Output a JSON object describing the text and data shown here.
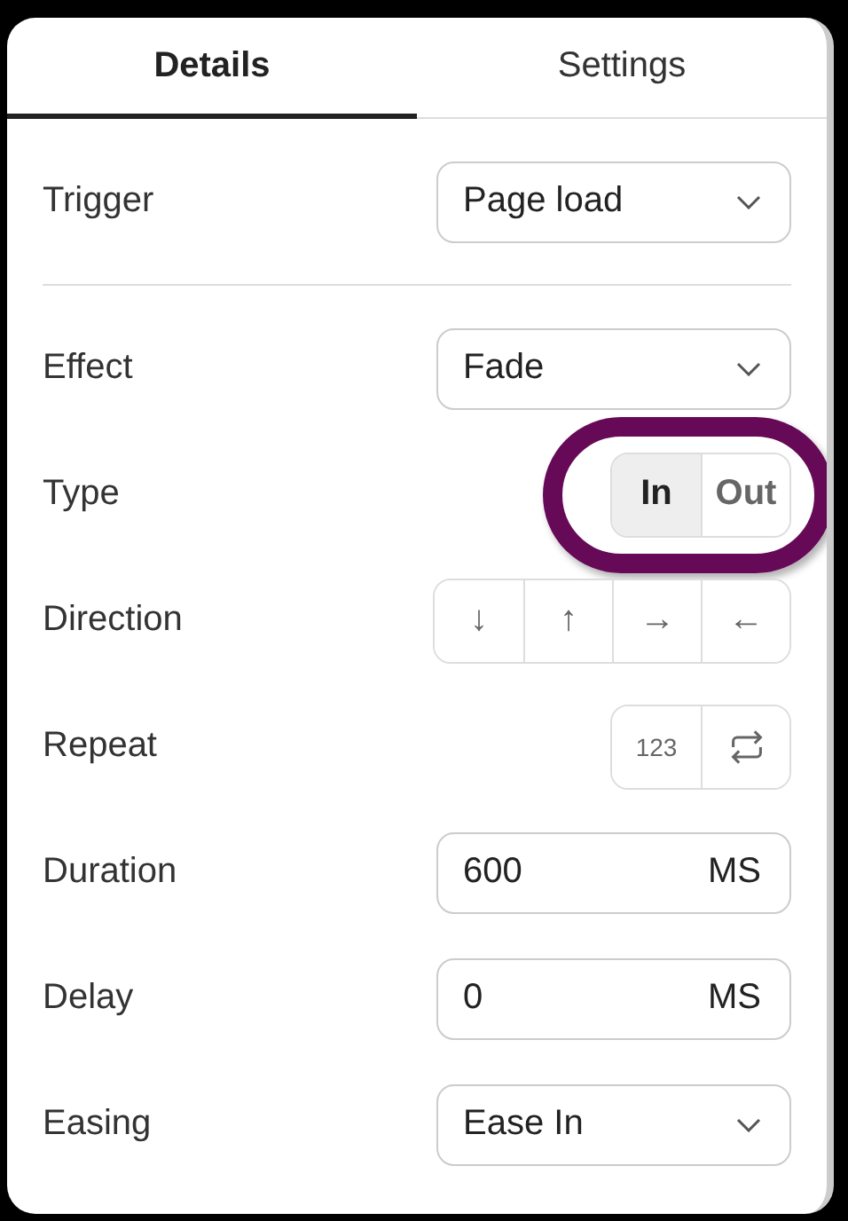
{
  "tabs": [
    {
      "label": "Details",
      "selected": true
    },
    {
      "label": "Settings",
      "selected": false
    }
  ],
  "rows": [
    {
      "kind": "select",
      "label": "Trigger",
      "value": "Page load",
      "divider_after": true
    },
    {
      "kind": "select",
      "label": "Effect",
      "value": "Fade"
    },
    {
      "kind": "segmented",
      "label": "Type",
      "highlighted": true,
      "options": [
        {
          "label": "In",
          "selected": true
        },
        {
          "label": "Out",
          "selected": false
        }
      ]
    },
    {
      "kind": "segmented",
      "label": "Direction",
      "options": [
        {
          "label": "↓",
          "selected": false
        },
        {
          "label": "↑",
          "selected": false
        },
        {
          "label": "→",
          "selected": false
        },
        {
          "label": "←",
          "selected": false
        }
      ]
    },
    {
      "kind": "segmented",
      "label": "Repeat",
      "options": [
        {
          "kind": "counter",
          "label": "123",
          "selected": false
        },
        {
          "kind": "repeat-icon",
          "selected": false
        }
      ]
    },
    {
      "kind": "number",
      "label": "Duration",
      "value": "600",
      "unit": "MS"
    },
    {
      "kind": "number",
      "label": "Delay",
      "value": "0",
      "unit": "MS"
    },
    {
      "kind": "select",
      "label": "Easing",
      "value": "Ease In"
    }
  ]
}
